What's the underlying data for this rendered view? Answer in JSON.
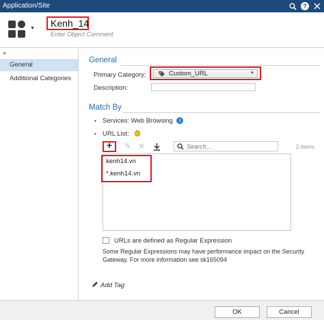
{
  "window": {
    "title": "Application/Site"
  },
  "header": {
    "object_name": "Kenh_14",
    "comment_placeholder": "Enter Object Comment"
  },
  "sidebar": {
    "collapse_glyph": "«",
    "items": [
      {
        "label": "General",
        "active": true
      },
      {
        "label": "Additional Categories",
        "active": false
      }
    ]
  },
  "general": {
    "title": "General",
    "primary_category_label": "Primary Category:",
    "primary_category_value": "Custom_URL",
    "description_label": "Description:"
  },
  "match_by": {
    "title": "Match By",
    "services_label": "Services: Web Browsing",
    "url_list_label": "URL List:",
    "search_placeholder": "Search...",
    "items_count": "2 items",
    "urls": [
      "kenh14.vn",
      "*.kenh14.vn"
    ],
    "regex_label": "URLs are defined as Regular Expression",
    "note": "Some Regular Expressions may have performance impact on the Security Gateway. For more information see sk165094"
  },
  "add_tag": "Add Tag",
  "footer": {
    "ok": "OK",
    "cancel": "Cancel"
  },
  "colors": {
    "titlebar": "#1d4a7a",
    "accent": "#2a6aa8",
    "highlight": "#e11b22",
    "selected": "#cfe1f3"
  },
  "icons": [
    "search-icon",
    "help-icon",
    "close-icon",
    "object-icon",
    "tag-icon",
    "info-icon",
    "bulb-icon",
    "add-icon",
    "edit-icon",
    "delete-icon",
    "import-icon",
    "pencil-icon"
  ]
}
